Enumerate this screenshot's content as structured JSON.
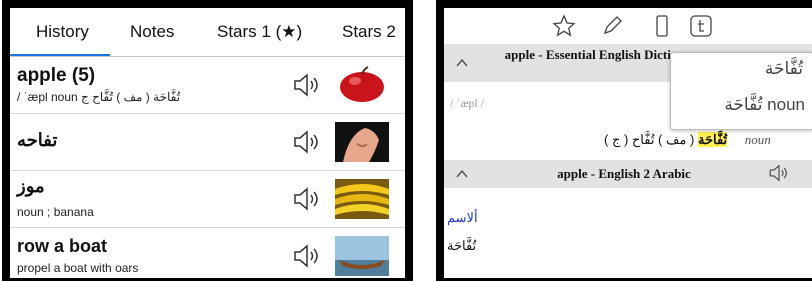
{
  "left": {
    "tabs": [
      "History",
      "Notes",
      "Stars 1 (★)",
      "Stars 2"
    ],
    "rows": [
      {
        "word": "apple (5)",
        "sub": "/ ˈæpl  noun   تُفَّاحَة ( مف ) تُفَّاح ج",
        "thumb": "apple"
      },
      {
        "word": "تفاحه",
        "sub": "",
        "thumb": "neck"
      },
      {
        "word": "موز",
        "sub": "noun ; banana",
        "thumb": "bananas"
      },
      {
        "word": "row a boat",
        "sub": "propel a boat with oars",
        "thumb": "boat"
      }
    ],
    "speaker_icon": "speaker-icon"
  },
  "right": {
    "toolbar_icons": [
      "star-icon",
      "pencil-icon",
      "phone-icon",
      "tumblr-icon"
    ],
    "section1_title": "apple - Essential English Dictionary",
    "pron": "/ ˈæpl /",
    "definition_ar": "تُفَّاحَة",
    "definition_rest": "( مف ) تُفَّاح ( ج )",
    "noun": "noun",
    "section2_title": "apple - English 2 Arabic",
    "ism": "ألاسم",
    "tuffaha": "تُفَّاحَة",
    "popup": {
      "line1": "تُفَّاحَة",
      "line2": "تُفَّاحَة noun"
    },
    "highlight_color": "#fff14d",
    "link_color": "#1a35d8"
  }
}
